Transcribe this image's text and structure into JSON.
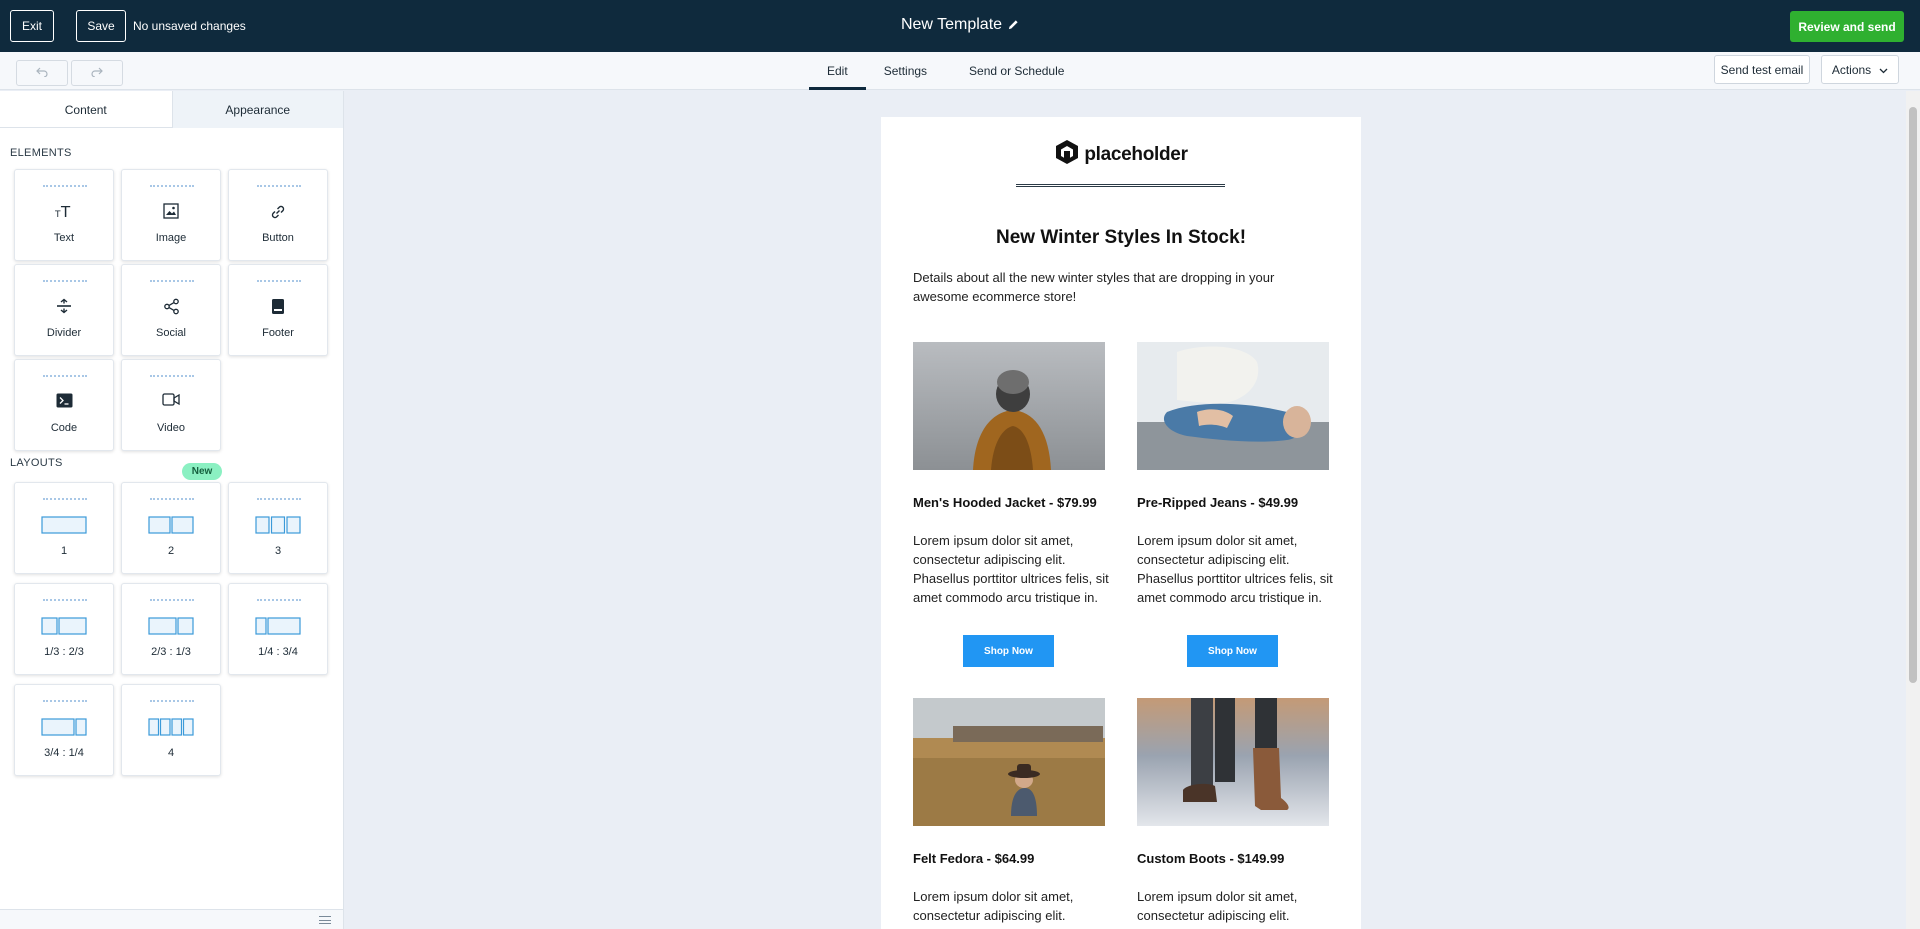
{
  "topbar": {
    "exit_label": "Exit",
    "save_label": "Save",
    "status": "No unsaved changes",
    "title": "New Template",
    "review_label": "Review and send"
  },
  "subbar": {
    "tabs": [
      "Edit",
      "Settings",
      "Send or Schedule"
    ],
    "active_tab": "Edit",
    "send_test_label": "Send test email",
    "actions_label": "Actions"
  },
  "panel": {
    "tabs": [
      "Content",
      "Appearance"
    ],
    "active_tab": "Content",
    "elements_heading": "ELEMENTS",
    "elements": [
      {
        "label": "Text",
        "icon": "text-size-icon"
      },
      {
        "label": "Image",
        "icon": "image-icon"
      },
      {
        "label": "Button",
        "icon": "link-icon"
      },
      {
        "label": "Divider",
        "icon": "divider-icon"
      },
      {
        "label": "Social",
        "icon": "share-icon"
      },
      {
        "label": "Footer",
        "icon": "footer-icon"
      },
      {
        "label": "Code",
        "icon": "terminal-icon"
      },
      {
        "label": "Video",
        "icon": "video-icon"
      }
    ],
    "new_badge": "New",
    "layouts_heading": "LAYOUTS",
    "layouts": [
      "1",
      "2",
      "3",
      "1/3 : 2/3",
      "2/3 : 1/3",
      "1/4 : 3/4",
      "3/4 : 1/4",
      "4"
    ]
  },
  "email": {
    "logo_text": "placeholder",
    "headline": "New Winter Styles In Stock!",
    "intro": "Details about all the new winter styles that are dropping in your awesome ecommerce store!",
    "products": [
      {
        "title": "Men's Hooded Jacket - $79.99",
        "desc": "Lorem ipsum dolor sit amet, consectetur adipiscing elit. Phasellus porttitor ultrices felis, sit amet commodo arcu tristique in.",
        "button": "Shop Now"
      },
      {
        "title": "Pre-Ripped Jeans - $49.99",
        "desc": "Lorem ipsum dolor sit amet, consectetur adipiscing elit. Phasellus porttitor ultrices felis, sit amet commodo arcu tristique in.",
        "button": "Shop Now"
      },
      {
        "title": "Felt Fedora - $64.99",
        "desc": "Lorem ipsum dolor sit amet, consectetur adipiscing elit."
      },
      {
        "title": "Custom Boots - $149.99",
        "desc": "Lorem ipsum dolor sit amet, consectetur adipiscing elit."
      }
    ]
  },
  "colors": {
    "topbar_bg": "#0f2a3d",
    "review_button": "#2fb030",
    "shop_button": "#2196f3",
    "new_badge": "#8bf0c2",
    "canvas_bg": "#eaeef5"
  }
}
